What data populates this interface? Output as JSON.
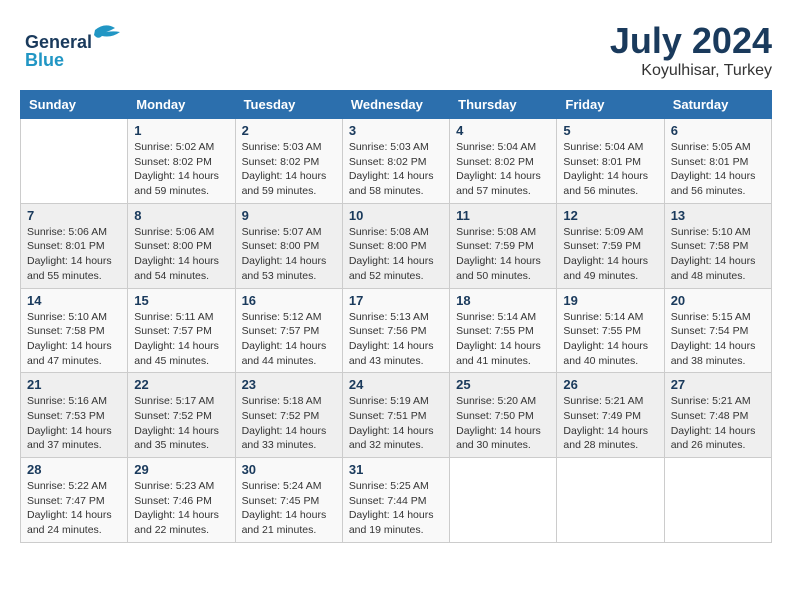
{
  "logo": {
    "part1": "General",
    "part2": "Blue"
  },
  "title": "July 2024",
  "location": "Koyulhisar, Turkey",
  "days_header": [
    "Sunday",
    "Monday",
    "Tuesday",
    "Wednesday",
    "Thursday",
    "Friday",
    "Saturday"
  ],
  "weeks": [
    [
      {
        "day": "",
        "data": ""
      },
      {
        "day": "1",
        "data": "Sunrise: 5:02 AM\nSunset: 8:02 PM\nDaylight: 14 hours\nand 59 minutes."
      },
      {
        "day": "2",
        "data": "Sunrise: 5:03 AM\nSunset: 8:02 PM\nDaylight: 14 hours\nand 59 minutes."
      },
      {
        "day": "3",
        "data": "Sunrise: 5:03 AM\nSunset: 8:02 PM\nDaylight: 14 hours\nand 58 minutes."
      },
      {
        "day": "4",
        "data": "Sunrise: 5:04 AM\nSunset: 8:02 PM\nDaylight: 14 hours\nand 57 minutes."
      },
      {
        "day": "5",
        "data": "Sunrise: 5:04 AM\nSunset: 8:01 PM\nDaylight: 14 hours\nand 56 minutes."
      },
      {
        "day": "6",
        "data": "Sunrise: 5:05 AM\nSunset: 8:01 PM\nDaylight: 14 hours\nand 56 minutes."
      }
    ],
    [
      {
        "day": "7",
        "data": "Sunrise: 5:06 AM\nSunset: 8:01 PM\nDaylight: 14 hours\nand 55 minutes."
      },
      {
        "day": "8",
        "data": "Sunrise: 5:06 AM\nSunset: 8:00 PM\nDaylight: 14 hours\nand 54 minutes."
      },
      {
        "day": "9",
        "data": "Sunrise: 5:07 AM\nSunset: 8:00 PM\nDaylight: 14 hours\nand 53 minutes."
      },
      {
        "day": "10",
        "data": "Sunrise: 5:08 AM\nSunset: 8:00 PM\nDaylight: 14 hours\nand 52 minutes."
      },
      {
        "day": "11",
        "data": "Sunrise: 5:08 AM\nSunset: 7:59 PM\nDaylight: 14 hours\nand 50 minutes."
      },
      {
        "day": "12",
        "data": "Sunrise: 5:09 AM\nSunset: 7:59 PM\nDaylight: 14 hours\nand 49 minutes."
      },
      {
        "day": "13",
        "data": "Sunrise: 5:10 AM\nSunset: 7:58 PM\nDaylight: 14 hours\nand 48 minutes."
      }
    ],
    [
      {
        "day": "14",
        "data": "Sunrise: 5:10 AM\nSunset: 7:58 PM\nDaylight: 14 hours\nand 47 minutes."
      },
      {
        "day": "15",
        "data": "Sunrise: 5:11 AM\nSunset: 7:57 PM\nDaylight: 14 hours\nand 45 minutes."
      },
      {
        "day": "16",
        "data": "Sunrise: 5:12 AM\nSunset: 7:57 PM\nDaylight: 14 hours\nand 44 minutes."
      },
      {
        "day": "17",
        "data": "Sunrise: 5:13 AM\nSunset: 7:56 PM\nDaylight: 14 hours\nand 43 minutes."
      },
      {
        "day": "18",
        "data": "Sunrise: 5:14 AM\nSunset: 7:55 PM\nDaylight: 14 hours\nand 41 minutes."
      },
      {
        "day": "19",
        "data": "Sunrise: 5:14 AM\nSunset: 7:55 PM\nDaylight: 14 hours\nand 40 minutes."
      },
      {
        "day": "20",
        "data": "Sunrise: 5:15 AM\nSunset: 7:54 PM\nDaylight: 14 hours\nand 38 minutes."
      }
    ],
    [
      {
        "day": "21",
        "data": "Sunrise: 5:16 AM\nSunset: 7:53 PM\nDaylight: 14 hours\nand 37 minutes."
      },
      {
        "day": "22",
        "data": "Sunrise: 5:17 AM\nSunset: 7:52 PM\nDaylight: 14 hours\nand 35 minutes."
      },
      {
        "day": "23",
        "data": "Sunrise: 5:18 AM\nSunset: 7:52 PM\nDaylight: 14 hours\nand 33 minutes."
      },
      {
        "day": "24",
        "data": "Sunrise: 5:19 AM\nSunset: 7:51 PM\nDaylight: 14 hours\nand 32 minutes."
      },
      {
        "day": "25",
        "data": "Sunrise: 5:20 AM\nSunset: 7:50 PM\nDaylight: 14 hours\nand 30 minutes."
      },
      {
        "day": "26",
        "data": "Sunrise: 5:21 AM\nSunset: 7:49 PM\nDaylight: 14 hours\nand 28 minutes."
      },
      {
        "day": "27",
        "data": "Sunrise: 5:21 AM\nSunset: 7:48 PM\nDaylight: 14 hours\nand 26 minutes."
      }
    ],
    [
      {
        "day": "28",
        "data": "Sunrise: 5:22 AM\nSunset: 7:47 PM\nDaylight: 14 hours\nand 24 minutes."
      },
      {
        "day": "29",
        "data": "Sunrise: 5:23 AM\nSunset: 7:46 PM\nDaylight: 14 hours\nand 22 minutes."
      },
      {
        "day": "30",
        "data": "Sunrise: 5:24 AM\nSunset: 7:45 PM\nDaylight: 14 hours\nand 21 minutes."
      },
      {
        "day": "31",
        "data": "Sunrise: 5:25 AM\nSunset: 7:44 PM\nDaylight: 14 hours\nand 19 minutes."
      },
      {
        "day": "",
        "data": ""
      },
      {
        "day": "",
        "data": ""
      },
      {
        "day": "",
        "data": ""
      }
    ]
  ]
}
